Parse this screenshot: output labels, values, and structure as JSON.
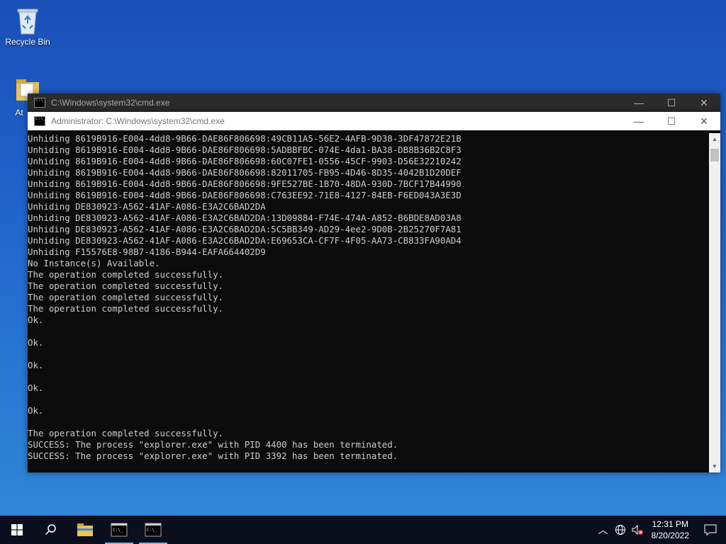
{
  "desktop": {
    "recycle_bin_label": "Recycle Bin",
    "second_icon_label": "At"
  },
  "back_window": {
    "title": "C:\\Windows\\system32\\cmd.exe"
  },
  "front_window": {
    "title": "Administrator: C:\\Windows\\system32\\cmd.exe",
    "console_lines": [
      "Unhiding 8619B916-E004-4dd8-9B66-DAE86F806698:49CB11A5-56E2-4AFB-9D38-3DF47872E21B",
      "Unhiding 8619B916-E004-4dd8-9B66-DAE86F806698:5ADBBFBC-074E-4da1-BA38-DB8B36B2C8F3",
      "Unhiding 8619B916-E004-4dd8-9B66-DAE86F806698:60C07FE1-0556-45CF-9903-D56E32210242",
      "Unhiding 8619B916-E004-4dd8-9B66-DAE86F806698:82011705-FB95-4D46-8D35-4042B1D20DEF",
      "Unhiding 8619B916-E004-4dd8-9B66-DAE86F806698:9FE527BE-1B70-48DA-930D-7BCF17B44990",
      "Unhiding 8619B916-E004-4dd8-9B66-DAE86F806698:C763EE92-71E8-4127-84EB-F6ED043A3E3D",
      "Unhiding DE830923-A562-41AF-A086-E3A2C6BAD2DA",
      "Unhiding DE830923-A562-41AF-A086-E3A2C6BAD2DA:13D09884-F74E-474A-A852-B6BDE8AD03A8",
      "Unhiding DE830923-A562-41AF-A086-E3A2C6BAD2DA:5C5BB349-AD29-4ee2-9D0B-2B25270F7A81",
      "Unhiding DE830923-A562-41AF-A086-E3A2C6BAD2DA:E69653CA-CF7F-4F05-AA73-CB833FA90AD4",
      "Unhiding F15576E8-98B7-4186-B944-EAFA664402D9",
      "No Instance(s) Available.",
      "The operation completed successfully.",
      "The operation completed successfully.",
      "The operation completed successfully.",
      "The operation completed successfully.",
      "Ok.",
      "",
      "Ok.",
      "",
      "Ok.",
      "",
      "Ok.",
      "",
      "Ok.",
      "",
      "The operation completed successfully.",
      "SUCCESS: The process \"explorer.exe\" with PID 4400 has been terminated.",
      "SUCCESS: The process \"explorer.exe\" with PID 3392 has been terminated."
    ]
  },
  "window_controls": {
    "minimize": "—",
    "maximize": "☐",
    "close": "✕"
  },
  "taskbar": {
    "clock_time": "12:31 PM",
    "clock_date": "8/20/2022"
  },
  "colors": {
    "console_bg": "#0c0c0c",
    "console_fg": "#cccccc",
    "taskbar_bg": "#0b0f1d"
  }
}
